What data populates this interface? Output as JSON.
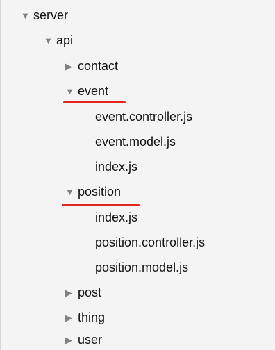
{
  "tree": {
    "server": {
      "label": "server",
      "arrow": "▼"
    },
    "api": {
      "label": "api",
      "arrow": "▼"
    },
    "contact": {
      "label": "contact",
      "arrow": "▶"
    },
    "event": {
      "label": "event",
      "arrow": "▼",
      "files": [
        "event.controller.js",
        "event.model.js",
        "index.js"
      ]
    },
    "position": {
      "label": "position",
      "arrow": "▼",
      "files": [
        "index.js",
        "position.controller.js",
        "position.model.js"
      ]
    },
    "post": {
      "label": "post",
      "arrow": "▶"
    },
    "thing": {
      "label": "thing",
      "arrow": "▶"
    },
    "user": {
      "label": "user",
      "arrow": "▶"
    }
  },
  "colors": {
    "annotation_underline": "#e3261d",
    "background": "#f4f4f4",
    "arrow": "#808080"
  }
}
